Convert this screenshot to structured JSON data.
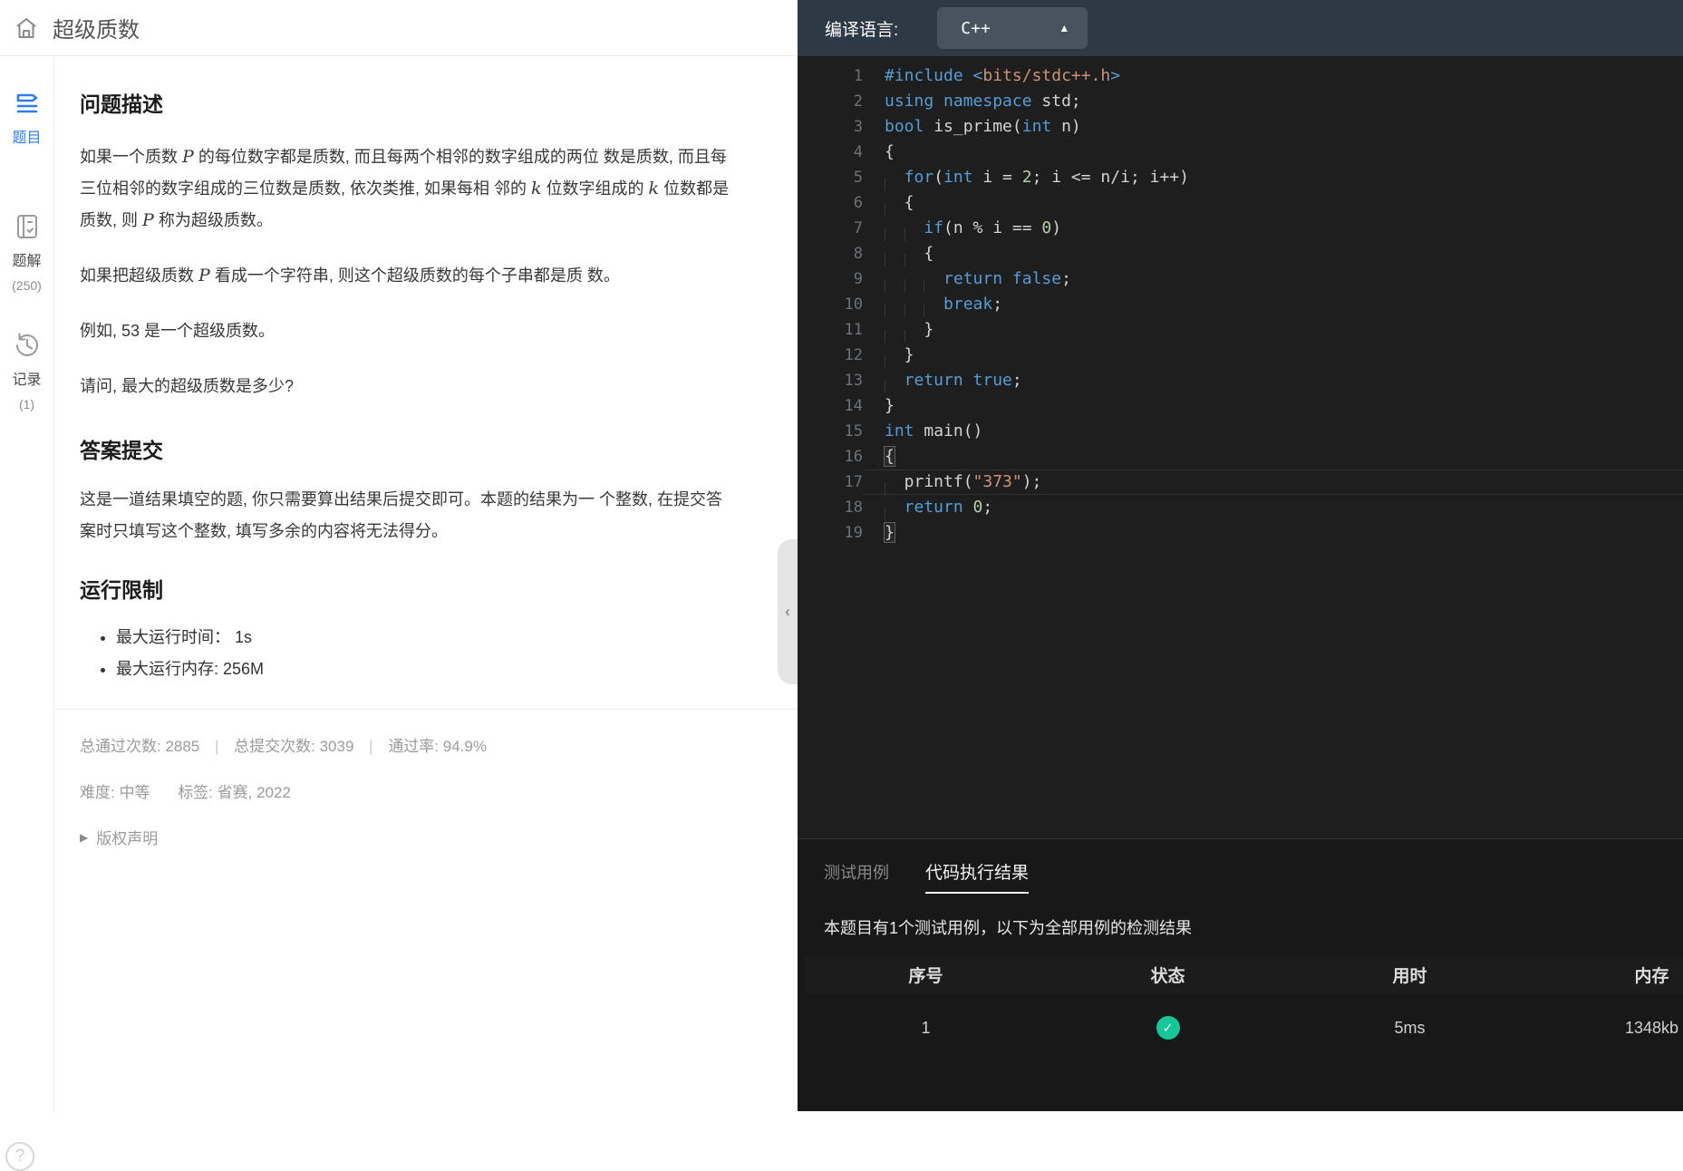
{
  "header": {
    "title": "超级质数"
  },
  "sidebar": {
    "items": [
      {
        "label": "题目",
        "count": ""
      },
      {
        "label": "题解",
        "count": "(250)"
      },
      {
        "label": "记录",
        "count": "(1)"
      }
    ],
    "help": "?"
  },
  "problem": {
    "description": {
      "heading": "问题描述",
      "paragraphs": [
        [
          {
            "t": "如果一个质数 "
          },
          {
            "t": "P",
            "m": 1
          },
          {
            "t": " 的每位数字都是质数, 而且每两个相邻的数字组成的两位 数是质数, 而且每三位相邻的数字组成的三位数是质数, 依次类推, 如果每相 邻的 "
          },
          {
            "t": "k",
            "m": 1
          },
          {
            "t": " 位数字组成的 "
          },
          {
            "t": "k",
            "m": 1
          },
          {
            "t": " 位数都是质数, 则 "
          },
          {
            "t": "P",
            "m": 1
          },
          {
            "t": " 称为超级质数。"
          }
        ],
        [
          {
            "t": "如果把超级质数 "
          },
          {
            "t": "P",
            "m": 1
          },
          {
            "t": " 看成一个字符串, 则这个超级质数的每个子串都是质 数。"
          }
        ],
        [
          {
            "t": "例如, 53 是一个超级质数。"
          }
        ],
        [
          {
            "t": "请问, 最大的超级质数是多少?"
          }
        ]
      ]
    },
    "submit": {
      "heading": "答案提交",
      "paragraphs": [
        [
          {
            "t": "这是一道结果填空的题, 你只需要算出结果后提交即可。本题的结果为一 个整数, 在提交答案时只填写这个整数, 填写多余的内容将无法得分。"
          }
        ]
      ]
    },
    "limits": {
      "heading": "运行限制",
      "bullets": [
        "最大运行时间： 1s",
        "最大运行内存: 256M"
      ]
    },
    "stats": {
      "passed": "总通过次数: 2885",
      "submitted": "总提交次数: 3039",
      "rate": "通过率: 94.9%",
      "sep": "|"
    },
    "meta": {
      "difficulty": "难度: 中等",
      "tags": "标签: 省赛, 2022"
    },
    "copyright": {
      "marker": "▶",
      "label": "版权声明"
    }
  },
  "collapse_handle": "‹",
  "editor": {
    "toolbar": {
      "label": "编译语言:",
      "selected": "C++",
      "caret": "▲"
    },
    "colors": {
      "keyword": "#569cd6",
      "string": "#ce9178",
      "number": "#b5cea8",
      "default": "#d4d4d4",
      "background": "#1e1e1e"
    },
    "lines": [
      {
        "n": 1,
        "g": 0,
        "t": [
          [
            "k",
            "#include"
          ],
          [
            "d",
            " "
          ],
          [
            "k",
            "<"
          ],
          [
            "s",
            "bits/stdc++.h"
          ],
          [
            "k",
            ">"
          ]
        ]
      },
      {
        "n": 2,
        "g": 0,
        "t": [
          [
            "k",
            "using"
          ],
          [
            "d",
            " "
          ],
          [
            "k",
            "namespace"
          ],
          [
            "d",
            " std;"
          ]
        ]
      },
      {
        "n": 3,
        "g": 0,
        "t": [
          [
            "k",
            "bool"
          ],
          [
            "d",
            " is_prime("
          ],
          [
            "k",
            "int"
          ],
          [
            "d",
            " n)"
          ]
        ]
      },
      {
        "n": 4,
        "g": 0,
        "t": [
          [
            "d",
            "{"
          ]
        ]
      },
      {
        "n": 5,
        "g": 1,
        "t": [
          [
            "k",
            "for"
          ],
          [
            "d",
            "("
          ],
          [
            "k",
            "int"
          ],
          [
            "d",
            " i = "
          ],
          [
            "n",
            "2"
          ],
          [
            "d",
            "; i <= n/i; i++)"
          ]
        ]
      },
      {
        "n": 6,
        "g": 1,
        "t": [
          [
            "d",
            "{"
          ]
        ]
      },
      {
        "n": 7,
        "g": 2,
        "t": [
          [
            "k",
            "if"
          ],
          [
            "d",
            "(n % i == "
          ],
          [
            "n",
            "0"
          ],
          [
            "d",
            ")"
          ]
        ]
      },
      {
        "n": 8,
        "g": 2,
        "t": [
          [
            "d",
            "{"
          ]
        ]
      },
      {
        "n": 9,
        "g": 3,
        "t": [
          [
            "k",
            "return"
          ],
          [
            "d",
            " "
          ],
          [
            "k",
            "false"
          ],
          [
            "d",
            ";"
          ]
        ]
      },
      {
        "n": 10,
        "g": 3,
        "t": [
          [
            "k",
            "break"
          ],
          [
            "d",
            ";"
          ]
        ]
      },
      {
        "n": 11,
        "g": 2,
        "t": [
          [
            "d",
            "}"
          ]
        ]
      },
      {
        "n": 12,
        "g": 1,
        "t": [
          [
            "d",
            "}"
          ]
        ]
      },
      {
        "n": 13,
        "g": 1,
        "t": [
          [
            "k",
            "return"
          ],
          [
            "d",
            " "
          ],
          [
            "k",
            "true"
          ],
          [
            "d",
            ";"
          ]
        ]
      },
      {
        "n": 14,
        "g": 0,
        "t": [
          [
            "d",
            "}"
          ]
        ]
      },
      {
        "n": 15,
        "g": 0,
        "t": [
          [
            "k",
            "int"
          ],
          [
            "d",
            " main()"
          ]
        ]
      },
      {
        "n": 16,
        "g": 0,
        "t": [
          [
            "b",
            "{"
          ]
        ]
      },
      {
        "n": 17,
        "g": 1,
        "active": 1,
        "t": [
          [
            "d",
            "printf("
          ],
          [
            "s",
            "\"373\""
          ],
          [
            "d",
            ");"
          ]
        ]
      },
      {
        "n": 18,
        "g": 1,
        "t": [
          [
            "k",
            "return"
          ],
          [
            "d",
            " "
          ],
          [
            "n",
            "0"
          ],
          [
            "d",
            ";"
          ]
        ]
      },
      {
        "n": 19,
        "g": 0,
        "t": [
          [
            "b",
            "}"
          ]
        ]
      }
    ]
  },
  "results": {
    "tabs": [
      {
        "label": "测试用例",
        "active": false
      },
      {
        "label": "代码执行结果",
        "active": true
      }
    ],
    "summary": "本题目有1个测试用例，以下为全部用例的检测结果",
    "table": {
      "headers": [
        "序号",
        "状态",
        "用时",
        "内存"
      ],
      "rows": [
        {
          "index": "1",
          "status": "pass",
          "time": "5ms",
          "memory": "1348kb"
        }
      ]
    },
    "status_color": "#16c79a"
  }
}
